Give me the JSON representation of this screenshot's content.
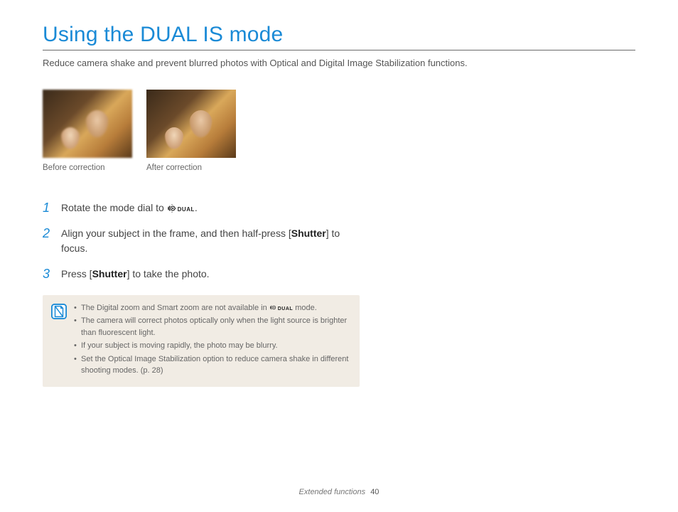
{
  "title": "Using the DUAL IS mode",
  "subtitle": "Reduce camera shake and prevent blurred photos with Optical and Digital Image Stabilization functions.",
  "captions": {
    "before": "Before correction",
    "after": "After correction"
  },
  "steps": [
    {
      "num": "1",
      "pre": "Rotate the mode dial to ",
      "post": "."
    },
    {
      "num": "2",
      "pre": "Align your subject in the frame, and then half-press [",
      "bold": "Shutter",
      "post": "] to focus."
    },
    {
      "num": "3",
      "pre": "Press [",
      "bold": "Shutter",
      "post": "] to take the photo."
    }
  ],
  "notes": {
    "item1_pre": "The Digital zoom and Smart zoom are not available in ",
    "item1_post": " mode.",
    "item2": "The camera will correct photos optically only when the light source is brighter than fluorescent light.",
    "item3": "If your subject is moving rapidly, the photo may be blurry.",
    "item4": "Set the Optical Image Stabilization option to reduce camera shake in different shooting modes. (p. 28)"
  },
  "icons": {
    "dual_label": "DUAL"
  },
  "footer": {
    "section": "Extended functions",
    "page": "40"
  }
}
